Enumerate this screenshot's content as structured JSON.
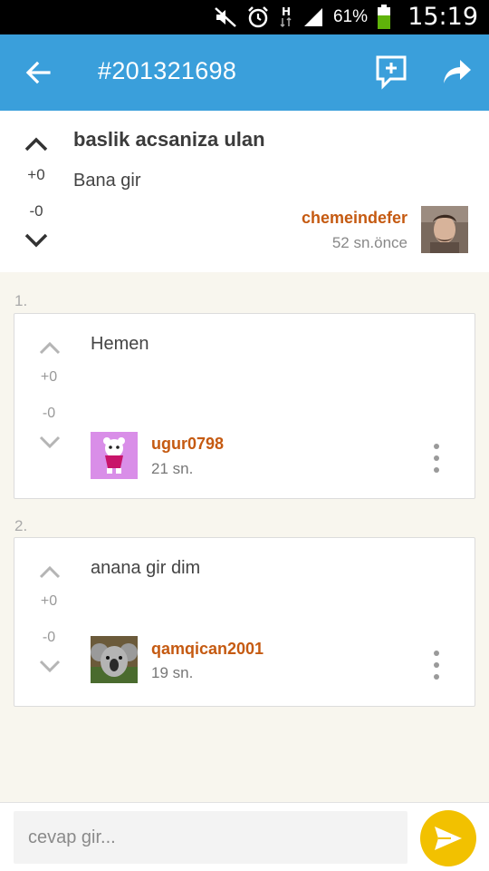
{
  "status_bar": {
    "battery_percent": "61%",
    "time": "15:19",
    "icons": [
      "mute-icon",
      "alarm-icon",
      "data-h-icon",
      "signal-icon",
      "battery-icon"
    ]
  },
  "app_bar": {
    "title": "#201321698",
    "color": "#3a9fdb",
    "icons": [
      "back-arrow-icon",
      "new-comment-icon",
      "share-icon"
    ]
  },
  "post": {
    "title": "baslik acsaniza ulan",
    "body": "Bana gir",
    "plus_votes": "+0",
    "minus_votes": "-0",
    "author": "chemeindefer",
    "time": "52 sn.önce"
  },
  "comments": [
    {
      "index": "1.",
      "body": "Hemen",
      "plus_votes": "+0",
      "minus_votes": "-0",
      "author": "ugur0798",
      "time": "21 sn."
    },
    {
      "index": "2.",
      "body": "anana gir dim",
      "plus_votes": "+0",
      "minus_votes": "-0",
      "author": "qamqican2001",
      "time": "19 sn."
    }
  ],
  "reply": {
    "placeholder": "cevap gir...",
    "send_color": "#f2c100"
  },
  "colors": {
    "author": "#c55a11",
    "background": "#f8f6ee"
  }
}
